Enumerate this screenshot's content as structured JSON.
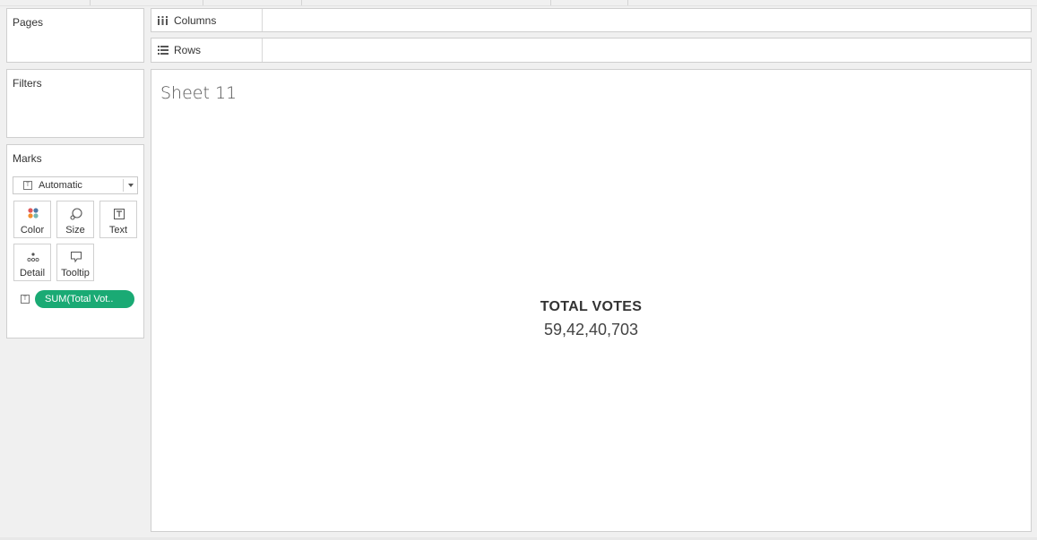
{
  "sidebar": {
    "pages_title": "Pages",
    "filters_title": "Filters",
    "marks": {
      "title": "Marks",
      "mark_type": "Automatic",
      "buttons": [
        {
          "label": "Color",
          "icon": "color-dots-icon"
        },
        {
          "label": "Size",
          "icon": "size-icon"
        },
        {
          "label": "Text",
          "icon": "text-icon"
        },
        {
          "label": "Detail",
          "icon": "detail-icon"
        },
        {
          "label": "Tooltip",
          "icon": "tooltip-icon"
        }
      ],
      "field_pill": "SUM(Total Vot..",
      "field_pill_color": "#1aaa74"
    }
  },
  "shelves": {
    "columns_label": "Columns",
    "rows_label": "Rows"
  },
  "view": {
    "sheet_title": "Sheet 11",
    "mark_header": "TOTAL VOTES",
    "mark_value": "59,42,40,703"
  }
}
